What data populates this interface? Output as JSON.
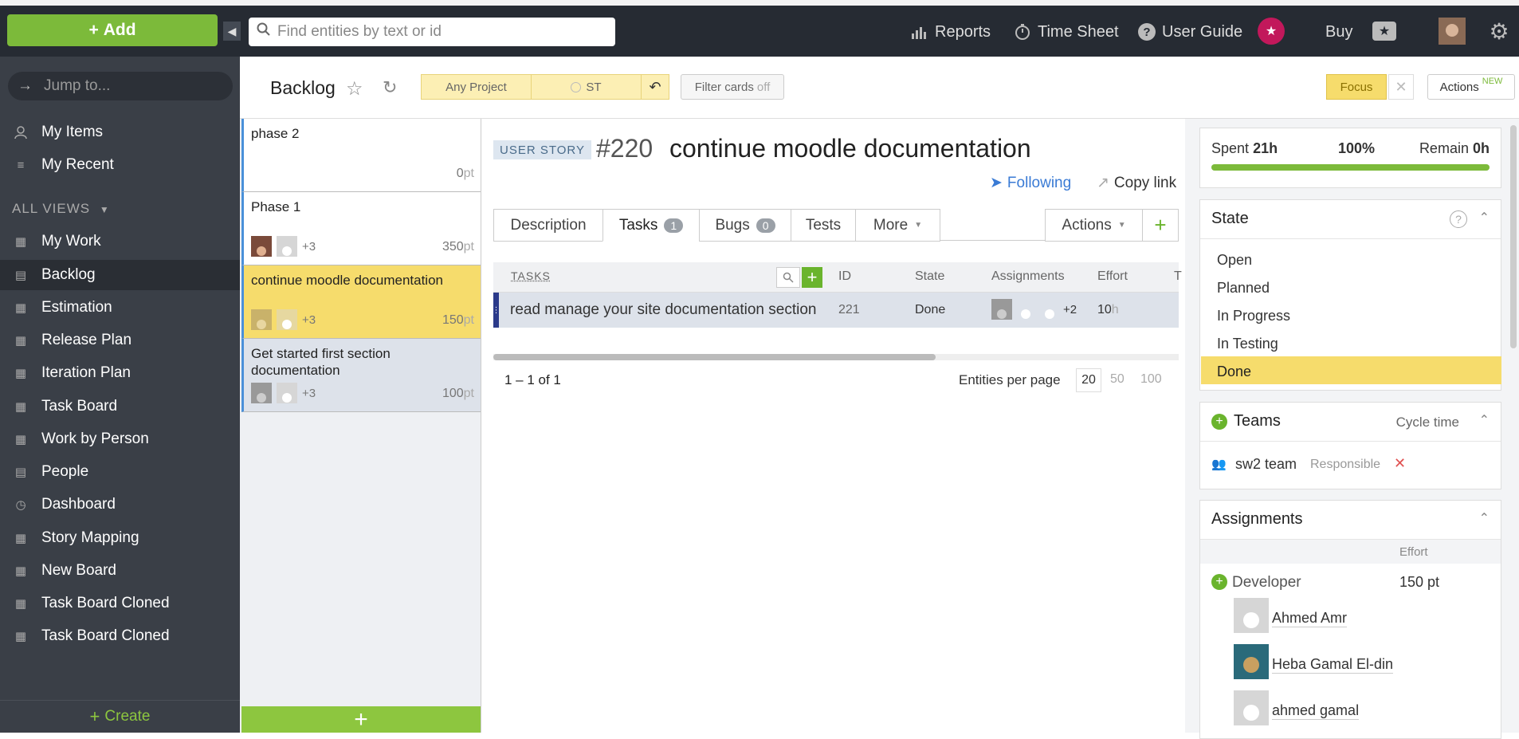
{
  "topbar": {
    "add_label": "Add",
    "search_placeholder": "Find entities by text or id",
    "reports": "Reports",
    "timesheet": "Time Sheet",
    "userguide": "User Guide",
    "buy": "Buy"
  },
  "sidebar": {
    "jump_placeholder": "Jump to...",
    "my_items": "My Items",
    "my_recent": "My Recent",
    "all_views": "ALL VIEWS",
    "items": [
      {
        "label": "My Work"
      },
      {
        "label": "Backlog"
      },
      {
        "label": "Estimation"
      },
      {
        "label": "Release Plan"
      },
      {
        "label": "Iteration Plan"
      },
      {
        "label": "Task Board"
      },
      {
        "label": "Work by Person"
      },
      {
        "label": "People"
      },
      {
        "label": "Dashboard"
      },
      {
        "label": "Story Mapping"
      },
      {
        "label": "New Board"
      },
      {
        "label": "Task Board Cloned"
      },
      {
        "label": "Task Board Cloned"
      }
    ],
    "create_label": "Create"
  },
  "viewheader": {
    "title": "Backlog",
    "project_filter": "Any Project",
    "team_filter": "ST",
    "filter_cards": "Filter cards",
    "filter_state": "off",
    "focus": "Focus",
    "actions": "Actions",
    "new_badge": "NEW"
  },
  "cards": [
    {
      "title": "phase 2",
      "points": "0",
      "unit": "pt",
      "extra": ""
    },
    {
      "title": "Phase 1",
      "points": "350",
      "unit": "pt",
      "extra": "+3"
    },
    {
      "title": "continue moodle documentation",
      "points": "150",
      "unit": "pt",
      "extra": "+3"
    },
    {
      "title": "Get started first section documentation",
      "points": "100",
      "unit": "pt",
      "extra": "+3"
    }
  ],
  "detail": {
    "type": "USER STORY",
    "id": "#220",
    "title": "continue moodle documentation",
    "following": "Following",
    "copy_link": "Copy link",
    "tabs": {
      "description": "Description",
      "tasks": "Tasks",
      "tasks_count": "1",
      "bugs": "Bugs",
      "bugs_count": "0",
      "tests": "Tests",
      "more": "More",
      "actions": "Actions"
    },
    "grid": {
      "headers": {
        "tasks": "TASKS",
        "id": "ID",
        "state": "State",
        "assignments": "Assignments",
        "effort": "Effort",
        "t": "T"
      },
      "row": {
        "name": "read manage your site documentation section",
        "id": "221",
        "state": "Done",
        "extra": "+2",
        "effort": "10",
        "effort_unit": "h"
      }
    },
    "pagination": {
      "range": "1 – 1 of 1",
      "per_page_label": "Entities per page",
      "options": [
        "20",
        "50",
        "100"
      ]
    }
  },
  "right": {
    "spent_label": "Spent",
    "spent": "21h",
    "percent": "100%",
    "remain_label": "Remain",
    "remain": "0h",
    "progress": 1.0,
    "state": {
      "title": "State",
      "options": [
        "Open",
        "Planned",
        "In Progress",
        "In Testing",
        "Done"
      ],
      "selected": "Done"
    },
    "teams": {
      "title": "Teams",
      "cycle_time": "Cycle time",
      "team": "sw2 team",
      "role": "Responsible"
    },
    "assignments": {
      "title": "Assignments",
      "effort_label": "Effort",
      "role": "Developer",
      "role_effort": "150 pt",
      "people": [
        "Ahmed Amr",
        "Heba Gamal El-din",
        "ahmed gamal"
      ]
    }
  },
  "colors": {
    "accent_green": "#7cba3a",
    "highlight_yellow": "#f6dc6c",
    "sidebar": "#3a3f47",
    "topbar": "#262b33"
  }
}
